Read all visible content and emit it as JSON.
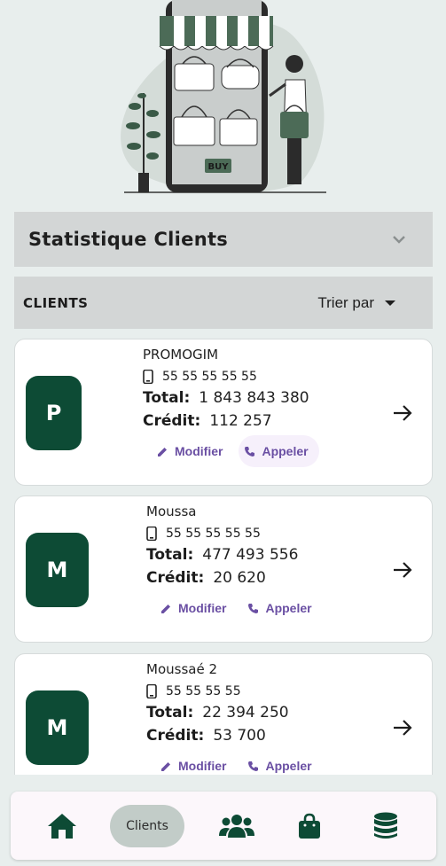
{
  "stats": {
    "title": "Statistique Clients"
  },
  "clients_header": {
    "label": "CLIENTS",
    "sort_label": "Trier par"
  },
  "clients": [
    {
      "initial": "P",
      "name": "PROMOGIM",
      "phone": "55 55 55 55 55",
      "total_label": "Total:",
      "total": "1 843 843 380",
      "credit_label": "Crédit:",
      "credit": "112 257",
      "edit_label": "Modifier",
      "call_label": "Appeler"
    },
    {
      "initial": "M",
      "name": "Moussa",
      "phone": "55 55 55 55 55",
      "total_label": "Total:",
      "total": "477 493 556",
      "credit_label": "Crédit:",
      "credit": "20 620",
      "edit_label": "Modifier",
      "call_label": "Appeler"
    },
    {
      "initial": "M",
      "name": "Moussaé 2",
      "phone": "55 55 55 55",
      "total_label": "Total:",
      "total": "22 394 250",
      "credit_label": "Crédit:",
      "credit": "53 700",
      "edit_label": "Modifier",
      "call_label": "Appeler"
    }
  ],
  "hero": {
    "buy_label": "BUY"
  },
  "bottom_nav": {
    "items": [
      {
        "icon": "home-icon"
      },
      {
        "label": "Clients"
      },
      {
        "icon": "users-icon"
      },
      {
        "icon": "shopping-bag-icon"
      },
      {
        "icon": "database-icon"
      }
    ]
  },
  "colors": {
    "accent": "#0d4b35",
    "link": "#6a4fa3",
    "background": "#e8eeed",
    "panel": "#d3d6d6"
  }
}
